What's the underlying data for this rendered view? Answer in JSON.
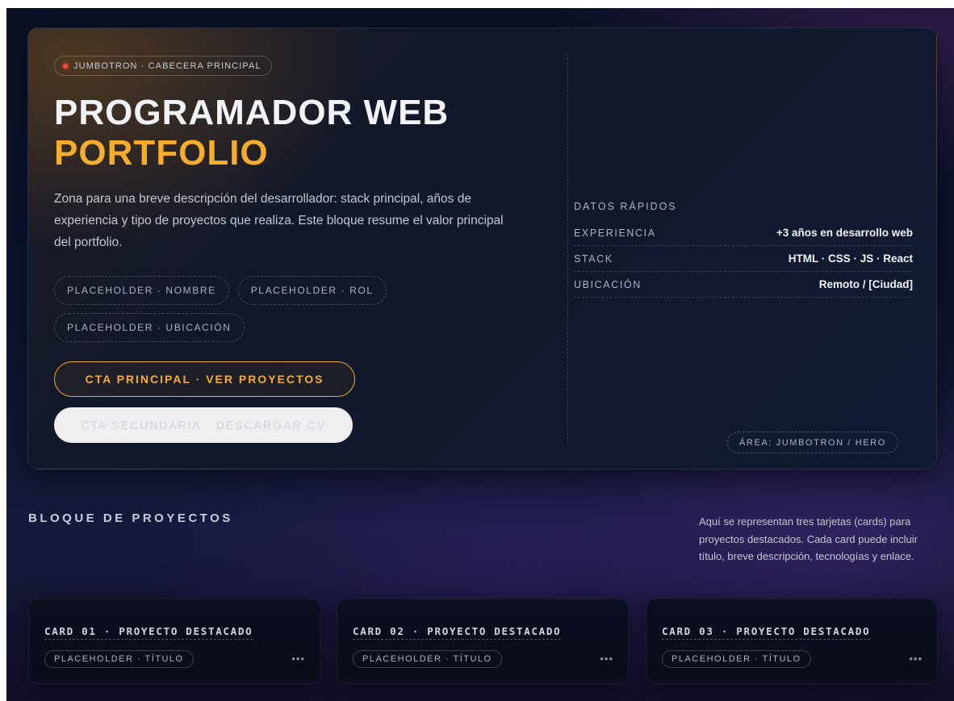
{
  "hero": {
    "tag_label": "JUMBOTRON · CABECERA PRINCIPAL",
    "title_line1": "PROGRAMADOR WEB",
    "title_line2": "PORTFOLIO",
    "description": "Zona para una breve descripción del desarrollador: stack principal, años de experiencia y tipo de proyectos que realiza. Este bloque resume el valor principal del portfolio.",
    "chips": [
      "PLACEHOLDER · NOMBRE",
      "PLACEHOLDER · ROL",
      "PLACEHOLDER · UBICACIÓN"
    ],
    "cta_primary": "CTA PRINCIPAL · VER PROYECTOS",
    "cta_secondary": "CTA SECUNDARIA · DESCARGAR CV",
    "quick_data_title": "DATOS RÁPIDOS",
    "facts": [
      {
        "key": "EXPERIENCIA",
        "value": "+3 años en desarrollo web"
      },
      {
        "key": "STACK",
        "value": "HTML · CSS · JS · React"
      },
      {
        "key": "UBICACIÓN",
        "value": "Remoto / [Ciudad]"
      }
    ],
    "area_label": "ÁREA: JUMBOTRON / HERO",
    "colors": {
      "accent": "#f7ad2c",
      "status_dot": "#ff4b3a"
    }
  },
  "projects": {
    "title": "BLOQUE DE PROYECTOS",
    "description": "Aquí se representan tres tarjetas (cards) para proyectos destacados. Cada card puede incluir título, breve descripción, tecnologías y enlace.",
    "cards": [
      {
        "title": "CARD 01 · PROYECTO DESTACADO",
        "tag": "PLACEHOLDER · TÍTULO",
        "more": "•••"
      },
      {
        "title": "CARD 02 · PROYECTO DESTACADO",
        "tag": "PLACEHOLDER · TÍTULO",
        "more": "•••"
      },
      {
        "title": "CARD 03 · PROYECTO DESTACADO",
        "tag": "PLACEHOLDER · TÍTULO",
        "more": "•••"
      }
    ]
  }
}
